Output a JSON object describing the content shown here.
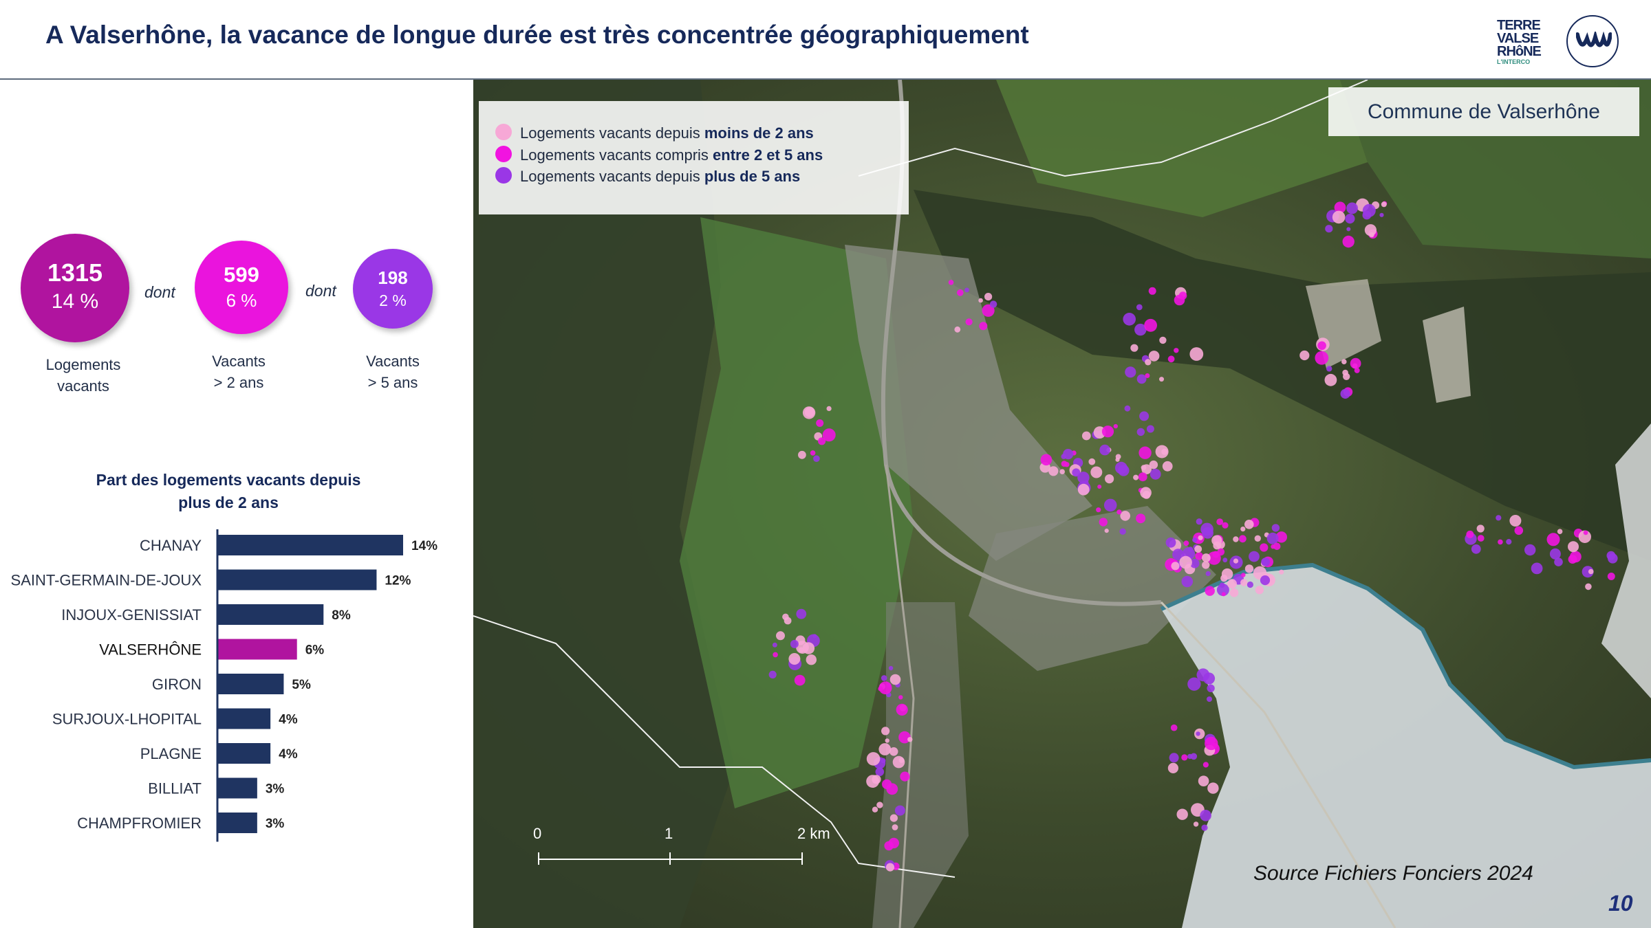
{
  "header": {
    "title": "A Valserhône, la vacance de longue durée est très concentrée géographiquement",
    "logo_text_lines": [
      "TERRE",
      "VALSE",
      "RHôNE"
    ],
    "logo_subtext": "L'INTERCO"
  },
  "kpis": [
    {
      "number": "1315",
      "percent": "14 %",
      "label_line1": "Logements",
      "label_line2": "vacants",
      "color": "#b0149f"
    },
    {
      "number": "599",
      "percent": "6 %",
      "label_line1": "Vacants",
      "label_line2": "> 2 ans",
      "color": "#ea14dd"
    },
    {
      "number": "198",
      "percent": "2 %",
      "label_line1": "Vacants",
      "label_line2": "> 5 ans",
      "color": "#9a37e6"
    }
  ],
  "connector_word": "dont",
  "chart_data": {
    "type": "bar",
    "orientation": "horizontal",
    "title": "Part des logements vacants depuis plus de 2 ans",
    "title_line1": "Part des logements vacants depuis",
    "title_line2": "plus de 2 ans",
    "categories": [
      "CHANAY",
      "SAINT-GERMAIN-DE-JOUX",
      "INJOUX-GENISSIAT",
      "VALSERHÔNE",
      "GIRON",
      "SURJOUX-LHOPITAL",
      "PLAGNE",
      "BILLIAT",
      "CHAMPFROMIER"
    ],
    "values": [
      14,
      12,
      8,
      6,
      5,
      4,
      4,
      3,
      3
    ],
    "value_labels": [
      "14%",
      "12%",
      "8%",
      "6%",
      "5%",
      "4%",
      "4%",
      "3%",
      "3%"
    ],
    "unit": "%",
    "highlight_category": "VALSERHÔNE",
    "bar_color": "#1f3461",
    "highlight_color": "#b0149f",
    "xlim": [
      0,
      14
    ]
  },
  "map": {
    "legend": [
      {
        "prefix": "Logements vacants depuis ",
        "emphasis": "moins de 2 ans",
        "color": "#f7a8d6"
      },
      {
        "prefix": "Logements vacants compris ",
        "emphasis": "entre 2 et 5 ans",
        "color": "#f114e0"
      },
      {
        "prefix": "Logements vacants depuis ",
        "emphasis": "plus de 5 ans",
        "color": "#9a37e6"
      }
    ],
    "commune_label": "Commune de Valserhône",
    "scale_labels": [
      "0",
      "1",
      "2 km"
    ],
    "source": "Source Fichiers Fonciers 2024"
  },
  "page_number": "10"
}
